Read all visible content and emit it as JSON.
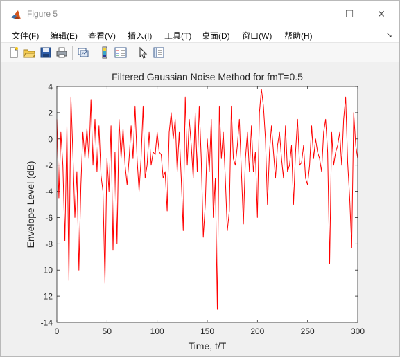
{
  "window": {
    "title": "Figure 5",
    "controls": {
      "minimize": "—",
      "maximize": "☐",
      "close": "✕"
    }
  },
  "menu": {
    "items": [
      {
        "label": "文件(F)"
      },
      {
        "label": "编辑(E)"
      },
      {
        "label": "查看(V)"
      },
      {
        "label": "插入(I)"
      },
      {
        "label": "工具(T)"
      },
      {
        "label": "桌面(D)"
      },
      {
        "label": "窗口(W)"
      },
      {
        "label": "帮助(H)"
      }
    ],
    "overflow_glyph": "↘"
  },
  "toolbar": {
    "buttons": [
      {
        "icon": "new-figure-icon"
      },
      {
        "icon": "open-file-icon"
      },
      {
        "icon": "save-icon"
      },
      {
        "icon": "print-icon"
      },
      {
        "icon": "link-plot-icon"
      },
      {
        "icon": "colorbar-icon"
      },
      {
        "icon": "legend-icon"
      },
      {
        "icon": "pointer-icon"
      },
      {
        "icon": "property-inspector-icon"
      }
    ]
  },
  "chart_data": {
    "type": "line",
    "title": "Filtered Gaussian Noise Method for fmT=0.5",
    "xlabel": "Time, t/T",
    "ylabel": "Envelope Level (dB)",
    "xlim": [
      0,
      300
    ],
    "ylim": [
      -14,
      4
    ],
    "xticks": [
      0,
      50,
      100,
      150,
      200,
      250,
      300
    ],
    "yticks": [
      4,
      2,
      0,
      -2,
      -4,
      -6,
      -8,
      -10,
      -12,
      -14
    ],
    "grid": false,
    "line_color": "#ff0000",
    "series": [
      {
        "x": [
          0,
          2,
          4,
          6,
          8,
          10,
          12,
          14,
          16,
          18,
          20,
          22,
          24,
          26,
          28,
          30,
          32,
          34,
          36,
          38,
          40,
          42,
          44,
          46,
          48,
          50,
          52,
          54,
          56,
          58,
          60,
          62,
          64,
          66,
          68,
          70,
          72,
          74,
          76,
          78,
          80,
          82,
          84,
          86,
          88,
          90,
          92,
          94,
          96,
          98,
          100,
          102,
          104,
          106,
          108,
          110,
          112,
          114,
          116,
          118,
          120,
          122,
          124,
          126,
          128,
          130,
          132,
          134,
          136,
          138,
          140,
          142,
          144,
          146,
          148,
          150,
          152,
          154,
          156,
          158,
          160,
          162,
          164,
          166,
          168,
          170,
          172,
          174,
          176,
          178,
          180,
          182,
          184,
          186,
          188,
          190,
          192,
          194,
          196,
          198,
          200,
          202,
          204,
          206,
          208,
          210,
          212,
          214,
          216,
          218,
          220,
          222,
          224,
          226,
          228,
          230,
          232,
          234,
          236,
          238,
          240,
          242,
          244,
          246,
          248,
          250,
          252,
          254,
          256,
          258,
          260,
          262,
          264,
          266,
          268,
          270,
          272,
          274,
          276,
          278,
          280,
          282,
          284,
          286,
          288,
          290,
          292,
          294,
          296,
          298,
          300
        ],
        "y": [
          1.5,
          -4.5,
          0.5,
          -2,
          -7.8,
          1,
          -10.8,
          3.2,
          -1,
          -6,
          -2.5,
          -10,
          -3.5,
          0.5,
          -1.5,
          0.8,
          -1.5,
          3,
          -2,
          1.5,
          -2.5,
          1,
          -2.8,
          -4,
          -11,
          -1.5,
          -4,
          1,
          -8.5,
          -1,
          -8,
          1.5,
          -1.5,
          0.8,
          -2,
          -3.5,
          -1.5,
          1,
          -1.5,
          2.5,
          -1.5,
          -4,
          -1.5,
          2.5,
          -3,
          -2,
          0.5,
          -2,
          -1,
          -1.2,
          0.5,
          -1,
          -1.2,
          -3,
          -2.5,
          -5.5,
          0.5,
          2,
          0,
          1.5,
          -2.5,
          0.5,
          -3,
          -7,
          3.2,
          -2,
          1.5,
          -0.5,
          -3,
          2,
          -2.5,
          2.5,
          -1.5,
          -7.5,
          -5,
          0,
          -2.5,
          1.5,
          -6,
          -3,
          -13,
          2.5,
          -1.5,
          0.5,
          -3,
          -7,
          -5.5,
          2.5,
          -1.5,
          -2,
          -0.5,
          1.5,
          -2.5,
          -6.5,
          -1.5,
          0.5,
          -2.5,
          1,
          -2.5,
          -1,
          -6,
          2,
          3.8,
          2.5,
          0,
          -5,
          -1,
          1,
          -1,
          -3,
          -0.5,
          0.5,
          -1.5,
          -3,
          1,
          -2.5,
          -2,
          -0.5,
          -5,
          -1,
          1.5,
          -2,
          -1.8,
          -0.5,
          -3,
          -3.5,
          -2,
          1,
          -1.5,
          0,
          -1,
          -1.5,
          -2.5,
          0.5,
          1.5,
          -1,
          -9.5,
          0.5,
          -2,
          -1,
          -0.5,
          0.5,
          -2,
          1.5,
          3.2,
          -1.8,
          -4.5,
          -8.3,
          2,
          -0.5,
          -1.5
        ]
      }
    ]
  }
}
